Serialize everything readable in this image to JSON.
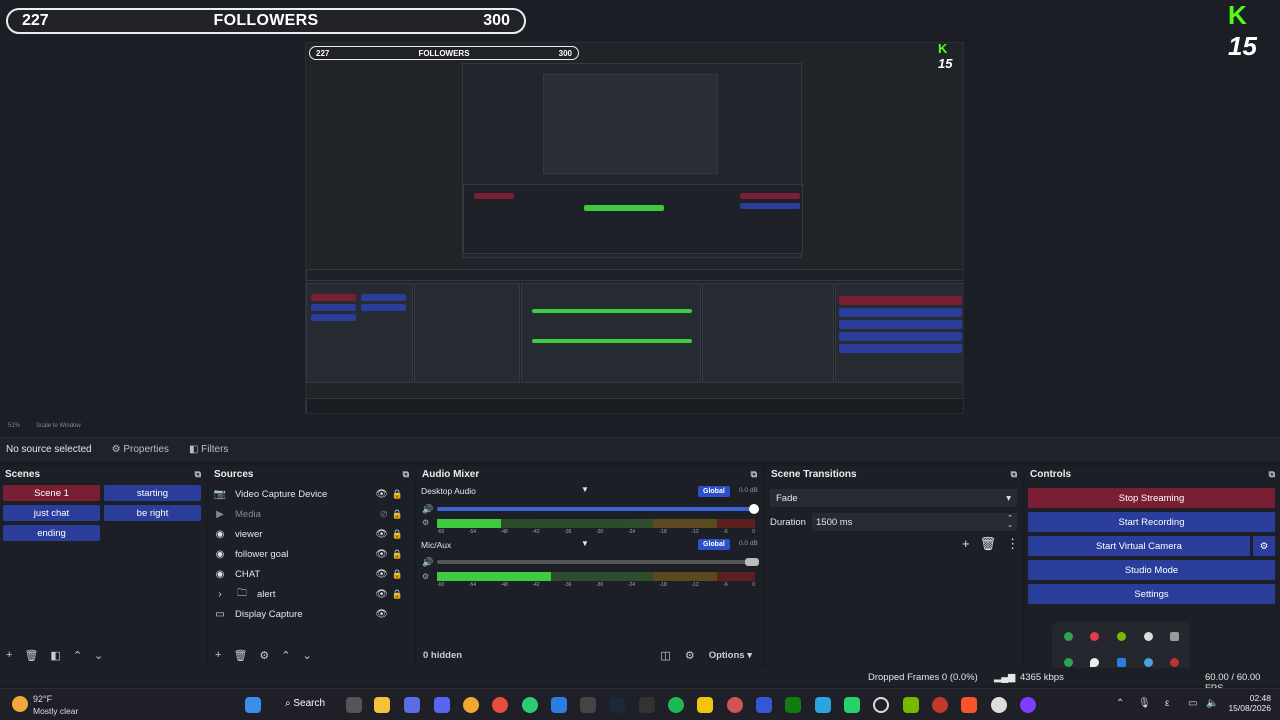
{
  "preview": {
    "follower_bar": {
      "current": "227",
      "label": "FOLLOWERS",
      "goal": "300"
    },
    "logo_number": "15",
    "nested_follower_bar": {
      "current": "227",
      "label": "FOLLOWERS",
      "goal": "300"
    },
    "nested_logo_number": "15",
    "zoom_info": "51%",
    "scale_mode": "Scale to Window"
  },
  "source_toolbar": {
    "status": "No source selected",
    "properties": "Properties",
    "filters": "Filters"
  },
  "scenes": {
    "title": "Scenes",
    "items": [
      "Scene 1",
      "starting",
      "just chat",
      "be right",
      "ending"
    ]
  },
  "sources": {
    "title": "Sources",
    "items": [
      "Video Capture Device",
      "Media",
      "viewer",
      "follower goal",
      "CHAT",
      "alert",
      "Display Capture"
    ]
  },
  "mixer": {
    "title": "Audio Mixer",
    "channels": [
      {
        "name": "Desktop Audio",
        "badge": "Global",
        "db": "0.0 dB",
        "level": 0.2
      },
      {
        "name": "Mic/Aux",
        "badge": "Global",
        "db": "0.0 dB",
        "level": 0.36
      }
    ],
    "scale": [
      "-60",
      "-54",
      "-48",
      "-42",
      "-36",
      "-30",
      "-24",
      "-18",
      "-12",
      "-6",
      "0"
    ],
    "hidden": "0 hidden",
    "options": "Options"
  },
  "transitions": {
    "title": "Scene Transitions",
    "type": "Fade",
    "duration_label": "Duration",
    "duration_value": "1500 ms"
  },
  "controls": {
    "title": "Controls",
    "buttons": [
      "Stop Streaming",
      "Start Recording",
      "Start Virtual Camera",
      "Studio Mode",
      "Settings"
    ]
  },
  "status": {
    "dropped": "Dropped Frames 0 (0.0%)",
    "bitrate": "4365 kbps",
    "fps": "60.00 / 60.00 FPS"
  },
  "taskbar": {
    "weather_temp": "92°F",
    "weather_desc": "Mostly clear",
    "search": "Search",
    "time": "02:48",
    "date": "15/08/2026"
  },
  "colors": {
    "accent_red": "#7a1f33",
    "accent_blue": "#2a3d9a",
    "meter_green": "#3ecb3e"
  }
}
